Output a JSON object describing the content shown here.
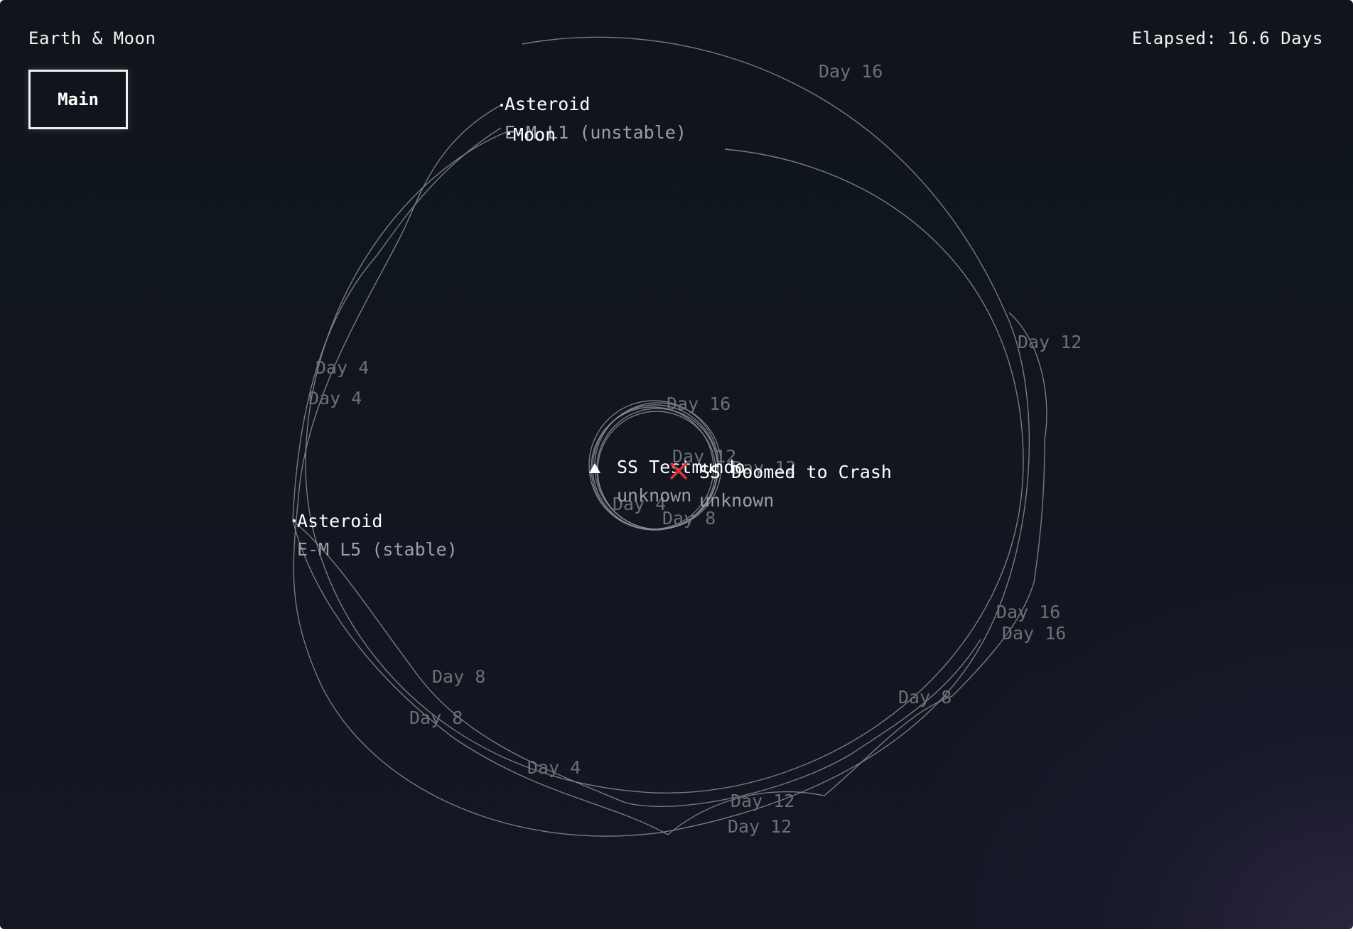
{
  "hud": {
    "scene_title": "Earth & Moon",
    "main_button": "Main",
    "elapsed": "Elapsed: 16.6 Days"
  },
  "bodies": {
    "asteroid_top": {
      "name": "Asteroid",
      "status": "E-M L1 (unstable)"
    },
    "moon": {
      "name": "Moon"
    },
    "asteroid_left": {
      "name": "Asteroid",
      "status": "E-M L5 (stable)"
    },
    "ship_test": {
      "name": "SS Testmundo",
      "status": "unknown"
    },
    "ship_doomed": {
      "name": "SS Doomed to Crash",
      "status": "unknown"
    }
  },
  "day_markers": {
    "d16_top": "Day 16",
    "d12_right": "Day 12",
    "d4_left_a": "Day 4",
    "d4_left_b": "Day 4",
    "d16_center": "Day 16",
    "d12_center_a": "Day 12",
    "d12_center_b": "Day 12",
    "d4_center": "Day 4",
    "d8_center": "Day 8",
    "d16_right_a": "Day 16",
    "d16_right_b": "Day 16",
    "d8_left_a": "Day 8",
    "d8_left_b": "Day 8",
    "d8_right": "Day 8",
    "d4_bottom": "Day 4",
    "d12_bottom_a": "Day 12",
    "d12_bottom_b": "Day 12"
  },
  "colors": {
    "background": "#10151c",
    "orbit_line": "#8a8d93",
    "crash_marker": "#e0303a",
    "label_primary": "#ffffff",
    "label_secondary": "#9a9ea6",
    "day_marker": "#6c6f76"
  },
  "icons": {
    "ship_test": "triangle-ship-icon",
    "ship_doomed": "crash-x-icon"
  }
}
